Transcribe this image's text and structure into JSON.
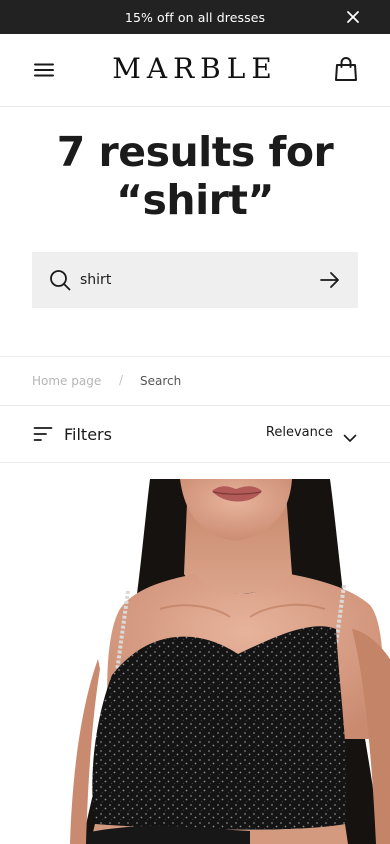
{
  "announcement": {
    "text": "15% off on all dresses",
    "close_icon": "close-icon"
  },
  "header": {
    "logo": "MARBLE",
    "menu_icon": "hamburger-menu-icon",
    "bag_icon": "shopping-bag-icon"
  },
  "results": {
    "line1": "7 results for",
    "line2": "“shirt”"
  },
  "search": {
    "value": "shirt",
    "placeholder": "",
    "search_icon": "search-icon",
    "submit_icon": "arrow-right-icon"
  },
  "breadcrumb": {
    "items": [
      "Home page",
      "Search"
    ],
    "separator": "/"
  },
  "filters": {
    "label": "Filters",
    "icon": "filter-lines-icon",
    "sort_value": "Relevance",
    "sort_icon": "chevron-down-icon"
  },
  "colors": {
    "announcement_bg": "#222222",
    "search_bg": "#efefef",
    "breadcrumb_muted": "#b5b5b5",
    "divider": "#ececec"
  }
}
